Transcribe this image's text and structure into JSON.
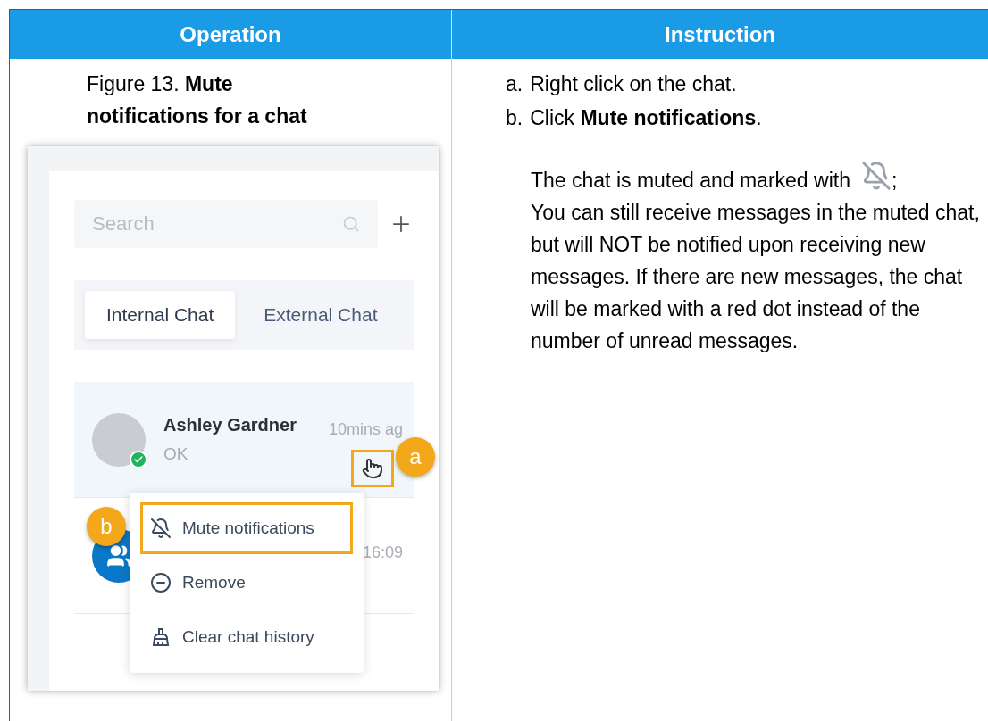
{
  "table": {
    "columns": [
      "Operation",
      "Instruction"
    ],
    "row": {
      "figure_caption": "Figure 13. **Mute notifications for a chat**",
      "figure": {
        "search": {
          "placeholder": "Search"
        },
        "tabs": [
          {
            "label": "Internal Chat",
            "selected": true
          },
          {
            "label": "External Chat",
            "selected": false
          }
        ],
        "chats": [
          {
            "name": "Ashley Gardner",
            "message": "OK",
            "time": "10mins ag",
            "selected": true,
            "kind": "photo",
            "online": true
          },
          {
            "time": "16:09",
            "selected": false,
            "kind": "group"
          }
        ],
        "context_menu": [
          {
            "kind": "mute",
            "label": "Mute notifications",
            "highlighted": true
          },
          {
            "kind": "remove",
            "label": "Remove",
            "highlighted": false
          },
          {
            "kind": "clear",
            "label": "Clear chat history",
            "highlighted": false
          }
        ],
        "callouts": [
          "a",
          "b"
        ]
      },
      "steps": [
        {
          "marker": "a.",
          "text": "Right click on the chat."
        },
        {
          "marker": "b.",
          "text": "Click **Mute notifications**."
        }
      ],
      "result_before_icon": "The chat is muted and marked with",
      "result_after_icon": ";",
      "result_note": "You can still receive messages in the muted chat, but will NOT be notified upon receiving new messages. If there are new messages, the chat will be marked with a red dot instead of the number of unread messages."
    }
  }
}
